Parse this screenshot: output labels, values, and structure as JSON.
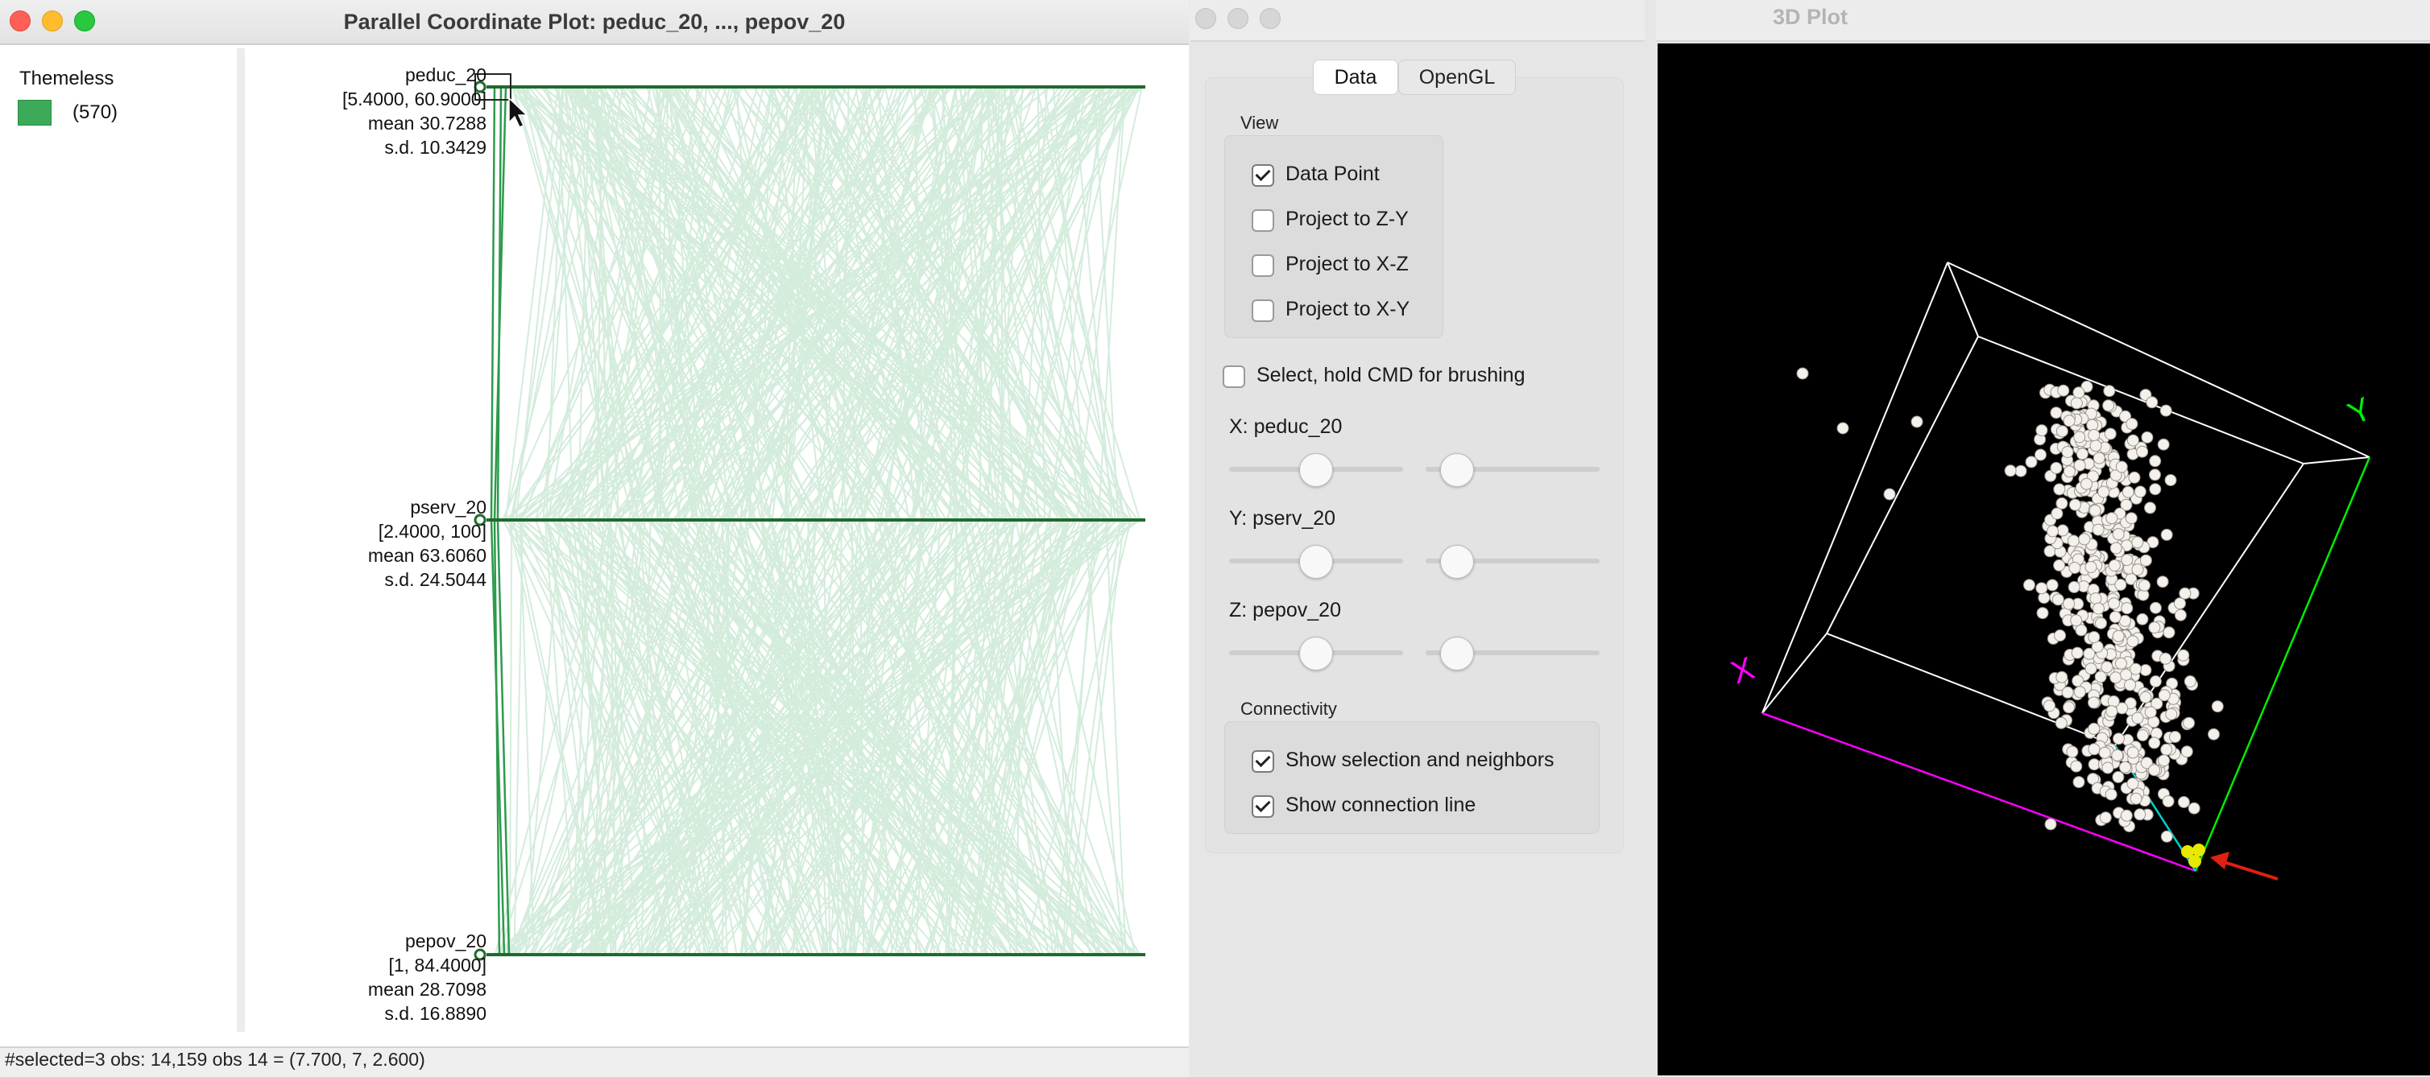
{
  "pcp_window": {
    "title": "Parallel Coordinate Plot: peduc_20, ..., pepov_20",
    "legend": {
      "title": "Themeless",
      "count": "(570)",
      "color": "#3daa5a"
    },
    "axes": [
      {
        "name": "peduc_20",
        "range": "[5.4000, 60.9000]",
        "mean": "mean  30.7288",
        "sd": "s.d.  10.3429"
      },
      {
        "name": "pserv_20",
        "range": "[2.4000, 100]",
        "mean": "mean  63.6060",
        "sd": "s.d.  24.5044"
      },
      {
        "name": "pepov_20",
        "range": "[1, 84.4000]",
        "mean": "mean  28.7098",
        "sd": "s.d.  16.8890"
      }
    ],
    "status": "#selected=3  obs: 14,159 obs 14 = (7.700, 7, 2.600)",
    "colors": {
      "selected_line": "#2e9a4c",
      "unselected_line": "#d4ecdc",
      "axis": "#1e6b2e"
    }
  },
  "plot3d_window": {
    "title": "3D Plot",
    "tabs": [
      "Data",
      "OpenGL"
    ],
    "view_group": {
      "title": "View",
      "options": [
        {
          "label": "Data Point",
          "checked": true
        },
        {
          "label": "Project to Z-Y",
          "checked": false
        },
        {
          "label": "Project to X-Z",
          "checked": false
        },
        {
          "label": "Project to X-Y",
          "checked": false
        }
      ]
    },
    "select_brushing": {
      "label": "Select, hold CMD for brushing",
      "checked": false
    },
    "sliders": [
      {
        "label": "X: peduc_20"
      },
      {
        "label": "Y: pserv_20"
      },
      {
        "label": "Z: pepov_20"
      }
    ],
    "connectivity": {
      "title": "Connectivity",
      "options": [
        {
          "label": "Show selection and neighbors",
          "checked": true
        },
        {
          "label": "Show connection line",
          "checked": true
        }
      ]
    },
    "axis_letters": {
      "x": "X",
      "y": "Y"
    },
    "colors": {
      "x_axis": "#ff00ff",
      "y_axis": "#00ff00",
      "connection": "#00c8c8",
      "selected_points": "#e8e800",
      "arrow": "#e02010"
    }
  }
}
